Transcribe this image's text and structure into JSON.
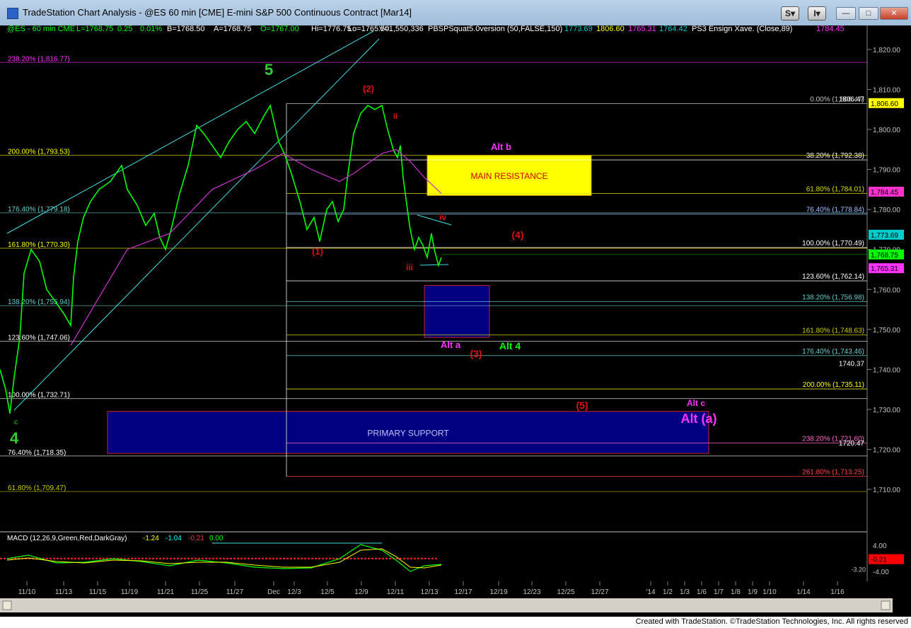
{
  "window": {
    "title": "TradeStation Chart Analysis - @ES 60 min [CME] E-mini S&P 500 Continuous Contract [Mar14]",
    "btn_s": "S",
    "btn_i": "I",
    "credit": "Created with TradeStation. ©TradeStation Technologies, Inc. All rights reserved"
  },
  "header": {
    "symbol": "@ES - 60 min  CME",
    "last": "L=1768.75",
    "chg": "0.25",
    "pct": "0.01%",
    "bid": "B=1768.50",
    "ask": "A=1768.75",
    "open": "O=1767.00",
    "hi": "Hi=1776.75",
    "lo": "Lo=1765.50",
    "vol": "V=1,550,336",
    "study": "PBSPSquat5.0version (50,FALSE,150)",
    "study_v1": "1773.69",
    "study_v2": "1806.60",
    "study_v3": "1765.31",
    "study_v4": "1764.42",
    "ensign": "PS3 Ensign Xave. (Close,89)",
    "ensign_v": "1784.45"
  },
  "colors": {
    "price": "#00ff00",
    "ma": "#cc33cc",
    "trendline": "#40e0e0",
    "wave_red": "#dd1111",
    "wave_green": "#33cc33",
    "alt_magenta": "#ff33ff",
    "resistance": "#ffff00",
    "support": "#000080"
  },
  "chart_data": {
    "type": "line",
    "title": "",
    "price_axis": {
      "ticks": [
        "1,820.00",
        "1,810.00",
        "1,800.00",
        "1,790.00",
        "1,780.00",
        "1,770.00",
        "1,760.00",
        "1,750.00",
        "1,740.00",
        "1,730.00",
        "1,720.00",
        "1,710.00"
      ],
      "tick_values": [
        1820,
        1810,
        1800,
        1790,
        1780,
        1770,
        1760,
        1750,
        1740,
        1730,
        1720,
        1710
      ],
      "ylim": [
        1703,
        1833
      ]
    },
    "date_axis": [
      "11/10",
      "11/13",
      "11/15",
      "11/19",
      "11/21",
      "11/25",
      "11/27",
      "Dec",
      "12/3",
      "12/5",
      "12/9",
      "12/11",
      "12/13",
      "12/17",
      "12/19",
      "12/23",
      "12/25",
      "12/27",
      "'14",
      "1/2",
      "1/3",
      "1/6",
      "1/7",
      "1/8",
      "1/9",
      "1/10",
      "1/14",
      "1/16"
    ],
    "price_path": [
      [
        0,
        1740
      ],
      [
        8,
        1735
      ],
      [
        14,
        1729
      ],
      [
        20,
        1738
      ],
      [
        28,
        1748
      ],
      [
        34,
        1764
      ],
      [
        44,
        1770
      ],
      [
        56,
        1767
      ],
      [
        66,
        1760
      ],
      [
        78,
        1757
      ],
      [
        90,
        1754
      ],
      [
        100,
        1751
      ],
      [
        104,
        1763
      ],
      [
        110,
        1772
      ],
      [
        118,
        1778
      ],
      [
        128,
        1782
      ],
      [
        140,
        1785
      ],
      [
        156,
        1787
      ],
      [
        172,
        1791
      ],
      [
        180,
        1785
      ],
      [
        194,
        1781
      ],
      [
        206,
        1776
      ],
      [
        218,
        1779
      ],
      [
        226,
        1773
      ],
      [
        234,
        1770
      ],
      [
        242,
        1775
      ],
      [
        254,
        1784
      ],
      [
        266,
        1791
      ],
      [
        278,
        1801
      ],
      [
        288,
        1799
      ],
      [
        300,
        1796
      ],
      [
        312,
        1793
      ],
      [
        324,
        1797
      ],
      [
        336,
        1800
      ],
      [
        348,
        1802
      ],
      [
        360,
        1799
      ],
      [
        372,
        1803
      ],
      [
        382,
        1806
      ],
      [
        394,
        1797
      ],
      [
        402,
        1794
      ],
      [
        412,
        1789
      ],
      [
        424,
        1782
      ],
      [
        434,
        1775
      ],
      [
        444,
        1778
      ],
      [
        452,
        1772
      ],
      [
        462,
        1780
      ],
      [
        470,
        1782
      ],
      [
        478,
        1777
      ],
      [
        486,
        1780
      ],
      [
        492,
        1789
      ],
      [
        500,
        1799
      ],
      [
        510,
        1804
      ],
      [
        520,
        1806
      ],
      [
        530,
        1805
      ],
      [
        540,
        1806
      ],
      [
        548,
        1800
      ],
      [
        556,
        1795
      ],
      [
        562,
        1793
      ],
      [
        566,
        1796
      ],
      [
        570,
        1788
      ],
      [
        576,
        1780
      ],
      [
        580,
        1775
      ],
      [
        586,
        1770
      ],
      [
        592,
        1773
      ],
      [
        598,
        1771
      ],
      [
        604,
        1768
      ],
      [
        610,
        1774
      ],
      [
        614,
        1770
      ],
      [
        620,
        1766
      ],
      [
        624,
        1768
      ]
    ],
    "ma_path": [
      [
        100,
        1746
      ],
      [
        140,
        1758
      ],
      [
        180,
        1770
      ],
      [
        240,
        1774
      ],
      [
        300,
        1785
      ],
      [
        360,
        1790
      ],
      [
        400,
        1794
      ],
      [
        440,
        1790
      ],
      [
        480,
        1787
      ],
      [
        500,
        1789
      ],
      [
        540,
        1794
      ],
      [
        560,
        1795
      ],
      [
        580,
        1792
      ],
      [
        600,
        1788
      ],
      [
        624,
        1784
      ]
    ],
    "last_price": 1768.75,
    "alt_b": "Alt b",
    "wave_5": "5",
    "wave_4": "4",
    "wave_c": "c",
    "fib_levels_right": [
      {
        "label": "0.00% (1,806.47)",
        "value": 1806.47
      },
      {
        "label": "38.20% (1,792.38)",
        "value": 1792.38
      },
      {
        "label": "61.80% (1,784.01)",
        "value": 1784.01
      },
      {
        "label": "76.40% (1,778.84)",
        "value": 1778.84
      },
      {
        "label": "100.00% (1,770.49)",
        "value": 1770.49
      },
      {
        "label": "123.60% (1,762.14)",
        "value": 1762.14
      },
      {
        "label": "138.20% (1,756.98)",
        "value": 1756.98
      },
      {
        "label": "161.80% (1,748.63)",
        "value": 1748.63
      },
      {
        "label": "176.40% (1,743.46)",
        "value": 1743.46
      },
      {
        "label": "200.00% (1,735.11)",
        "value": 1735.11
      },
      {
        "label": "238.20% (1,721.60)",
        "value": 1721.6
      },
      {
        "label": "261.80% (1,713.25)",
        "value": 1713.25
      }
    ],
    "fib_levels_left": [
      {
        "label": "238.20% (1,816.77)",
        "value": 1816.77
      },
      {
        "label": "200.00% (1,793.53)",
        "value": 1793.53
      },
      {
        "label": "176.40% (1,779.18)",
        "value": 1779.18
      },
      {
        "label": "161.80% (1,770.30)",
        "value": 1770.3
      },
      {
        "label": "138.20% (1,755.94)",
        "value": 1755.94
      },
      {
        "label": "123.60% (1,747.06)",
        "value": 1747.06
      },
      {
        "label": "100.00% (1,732.71)",
        "value": 1732.71
      },
      {
        "label": "76.40% (1,718.35)",
        "value": 1718.35
      },
      {
        "label": "61.80% (1,709.47)",
        "value": 1709.47
      }
    ],
    "value_tags": [
      {
        "label": "1806.47",
        "value": 1806.47
      },
      {
        "label": "1740.37",
        "value": 1740.37
      },
      {
        "label": "1720.47",
        "value": 1720.47
      }
    ],
    "right_badges": [
      {
        "label": "1,806.60",
        "value": 1806.6,
        "color": "#ffff00",
        "text_color": "#000000"
      },
      {
        "label": "1,784.45",
        "value": 1784.45,
        "color": "#ff33cc",
        "text_color": "#000000"
      },
      {
        "label": "1,773.69",
        "value": 1773.69,
        "color": "#00cccc",
        "text_color": "#000000"
      },
      {
        "label": "1,768.75",
        "value": 1768.75,
        "color": "#00ff00",
        "text_color": "#000000"
      },
      {
        "label": "1,765.31",
        "value": 1765.31,
        "color": "#ff33ff",
        "text_color": "#000000"
      }
    ],
    "zones": [
      {
        "label": "MAIN RESISTANCE",
        "top": 1793.5,
        "bottom": 1783.5,
        "fill": "#ffff00",
        "text_color": "#cc0000"
      },
      {
        "label": "",
        "top": 1761.0,
        "bottom": 1748.0,
        "fill": "#000080",
        "text_color": "#ffffff"
      },
      {
        "label": "PRIMARY SUPPORT",
        "top": 1729.5,
        "bottom": 1719.0,
        "fill": "#000080",
        "text_color": "#c0c0ff"
      }
    ],
    "wave_labels": [
      {
        "text": "(2)",
        "value": 1811,
        "color": "#dd1111"
      },
      {
        "text": "(1)",
        "value": 1768,
        "color": "#dd1111"
      },
      {
        "text": "(4)",
        "value": 1771,
        "color": "#dd1111"
      },
      {
        "text": "(3)",
        "value": 1744,
        "color": "#dd1111"
      },
      {
        "text": "(5)",
        "value": 1730,
        "color": "#dd1111"
      },
      {
        "text": "iii",
        "value": 1765,
        "color": "#dd1111"
      },
      {
        "text": "iv",
        "value": 1777,
        "color": "#dd1111"
      },
      {
        "text": "ii",
        "value": 1802,
        "color": "#dd1111"
      },
      {
        "text": "Alt a",
        "value": 1746,
        "color": "#ff33ff"
      },
      {
        "text": "Alt 4",
        "value": 1746,
        "color": "#00ff00"
      },
      {
        "text": "Alt c",
        "value": 1730,
        "color": "#ff33ff"
      },
      {
        "text": "Alt (a)",
        "value": 1724,
        "color": "#ff33ff"
      }
    ],
    "macd": {
      "legend_name": "MACD (12,26,9,Green,Red,DarkGray)",
      "v1": "-1.24",
      "v2": "-1.04",
      "v3": "-0.21",
      "v4": "0.00",
      "ticks": [
        "4.00",
        "-4.00"
      ],
      "tick_values": [
        4,
        -4
      ],
      "ylim": [
        -7,
        6
      ],
      "tag_a": "-0.21",
      "tag_b": "-3.20",
      "tag_c": "-4.00"
    }
  }
}
